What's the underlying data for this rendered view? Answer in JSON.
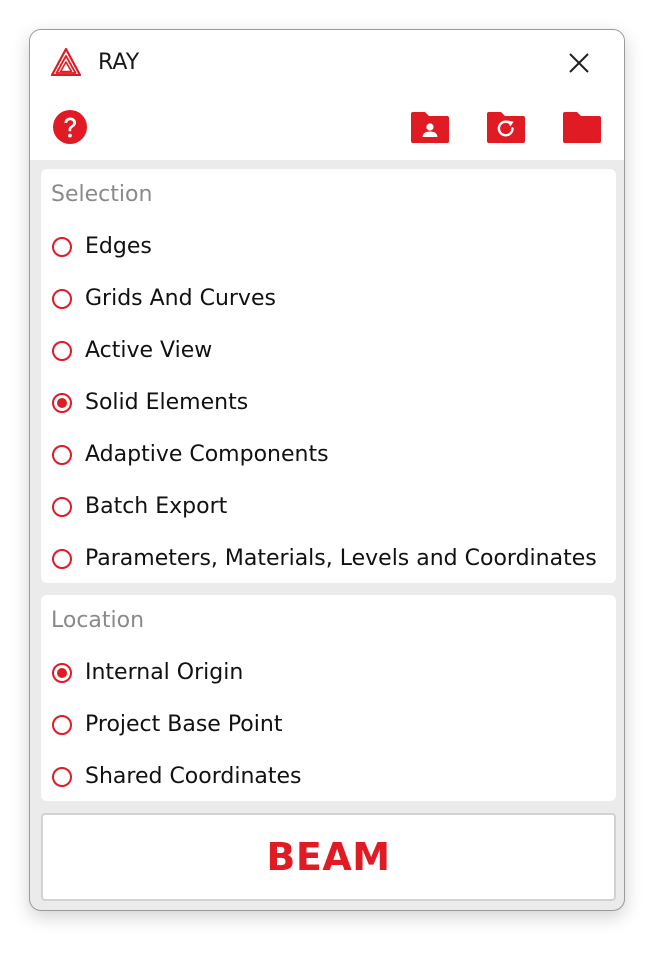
{
  "app": {
    "title": "RAY",
    "accent_color": "#e01b24",
    "logo_icon": "triangle-logo-icon",
    "close_icon": "close-icon"
  },
  "toolbar": {
    "help_icon": "question-circle-icon",
    "buttons": [
      {
        "icon": "folder-user-icon"
      },
      {
        "icon": "folder-refresh-icon"
      },
      {
        "icon": "folder-icon"
      }
    ]
  },
  "selection": {
    "title": "Selection",
    "options": [
      {
        "label": "Edges",
        "checked": false
      },
      {
        "label": "Grids And Curves",
        "checked": false
      },
      {
        "label": "Active View",
        "checked": false
      },
      {
        "label": "Solid Elements",
        "checked": true
      },
      {
        "label": "Adaptive Components",
        "checked": false
      },
      {
        "label": "Batch Export",
        "checked": false
      },
      {
        "label": "Parameters, Materials, Levels and Coordinates",
        "checked": false
      }
    ]
  },
  "location": {
    "title": "Location",
    "options": [
      {
        "label": "Internal Origin",
        "checked": true
      },
      {
        "label": "Project Base Point",
        "checked": false
      },
      {
        "label": "Shared Coordinates",
        "checked": false
      }
    ]
  },
  "action": {
    "label": "BEAM"
  }
}
